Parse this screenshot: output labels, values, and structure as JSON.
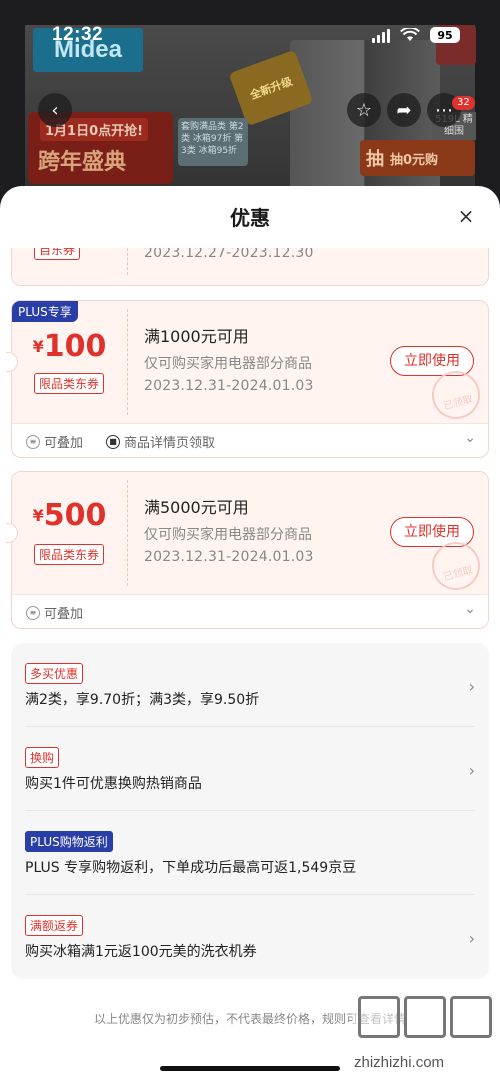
{
  "status_bar": {
    "time": "12:32",
    "battery": "95"
  },
  "background": {
    "brand_logo": "Midea",
    "promo_line1": "1月1日0点开抢!",
    "promo_line2": "跨年盛典",
    "offer_text": "套购满品类 第2类 冰箱97折 第3类 冰箱95折",
    "badge_text": "全新升级",
    "draw_big": "抽",
    "draw_small": "抽0元购",
    "size_label": "519L 精细围",
    "cart_count": "32"
  },
  "sheet": {
    "title": "优惠",
    "partial_coupon": {
      "tag": "自东券",
      "dates": "2023.12.27-2023.12.30"
    },
    "coupons": [
      {
        "plus_tag": "PLUS专享",
        "currency": "¥",
        "amount": "100",
        "type": "限品类东券",
        "condition": "满1000元可用",
        "scope": "仅可购买家用电器部分商品",
        "dates": "2023.12.31-2024.01.03",
        "button": "立即使用",
        "stamp": "已领取",
        "foot": [
          "可叠加",
          "商品详情页领取"
        ]
      },
      {
        "plus_tag": "",
        "currency": "¥",
        "amount": "500",
        "type": "限品类东券",
        "condition": "满5000元可用",
        "scope": "仅可购买家用电器部分商品",
        "dates": "2023.12.31-2024.01.03",
        "button": "立即使用",
        "stamp": "已领取",
        "foot": [
          "可叠加"
        ]
      }
    ],
    "promotions": [
      {
        "tag": "多买优惠",
        "text": "满2类，享9.70折；满3类，享9.50折",
        "chevron": true
      },
      {
        "tag": "换购",
        "text": "购买1件可优惠换购热销商品",
        "chevron": true
      },
      {
        "tag": "PLUS购物返利",
        "text": "PLUS 专享购物返利，下单成功后最高可返1,549京豆",
        "chevron": false
      },
      {
        "tag": "满额返券",
        "text": "购买冰箱满1元返100元美的洗衣机券",
        "chevron": true
      }
    ],
    "disclaimer": "以上优惠仅为初步预估，不代表最终价格，规则可查看详情"
  },
  "watermark": {
    "url": "zhizhizhi.com"
  }
}
